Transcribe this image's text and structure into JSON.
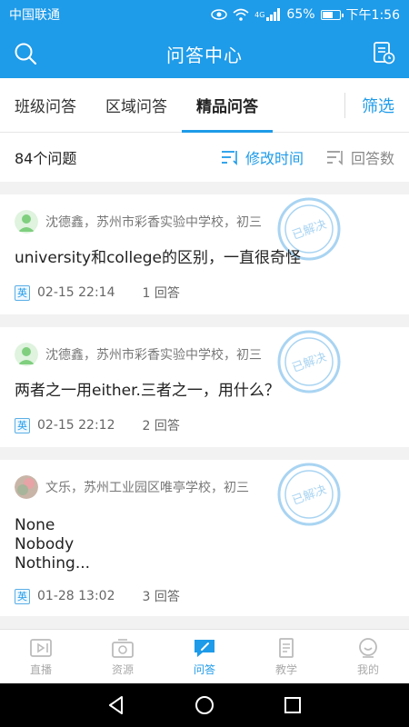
{
  "status": {
    "carrier": "中国联通",
    "network": "4G",
    "battery": "65%",
    "battery_level": 0.65,
    "time": "下午1:56"
  },
  "header": {
    "title": "问答中心",
    "left_icon": "search-icon",
    "right_icon": "document-clock-icon"
  },
  "tabs": [
    {
      "label": "班级问答",
      "active": false
    },
    {
      "label": "区域问答",
      "active": false
    },
    {
      "label": "精品问答",
      "active": true
    }
  ],
  "filter_label": "筛选",
  "sort": {
    "count": "84个问题",
    "by_time": "修改时间",
    "by_answers": "回答数"
  },
  "colors": {
    "accent": "#1e9be9",
    "stamp": "#9fd0f0"
  },
  "questions": [
    {
      "author": "沈德鑫，苏州市彩香实验中学校，初三",
      "avatar": "default-avatar",
      "stamp": "已解决",
      "text": "university和college的区别，一直很奇怪",
      "subject": "英",
      "date": "02-15 22:14",
      "answers": "1 回答"
    },
    {
      "author": "沈德鑫，苏州市彩香实验中学校，初三",
      "avatar": "default-avatar",
      "stamp": "已解决",
      "text": "两者之一用either.三者之一，用什么？",
      "subject": "英",
      "date": "02-15 22:12",
      "answers": "2 回答"
    },
    {
      "author": "文乐，苏州工业园区唯亭学校，初三",
      "avatar": "photo-avatar",
      "stamp": "已解决",
      "lines": [
        "None",
        "Nobody",
        "Nothing..."
      ],
      "subject": "英",
      "date": "01-28 13:02",
      "answers": "3 回答"
    }
  ],
  "tabbar": [
    {
      "label": "直播",
      "icon": "live-icon",
      "active": false
    },
    {
      "label": "资源",
      "icon": "resource-icon",
      "active": false
    },
    {
      "label": "问答",
      "icon": "qa-icon",
      "active": true
    },
    {
      "label": "教学",
      "icon": "teaching-icon",
      "active": false
    },
    {
      "label": "我的",
      "icon": "profile-icon",
      "active": false
    }
  ],
  "system_nav": [
    "back-icon",
    "home-icon",
    "recents-icon"
  ]
}
